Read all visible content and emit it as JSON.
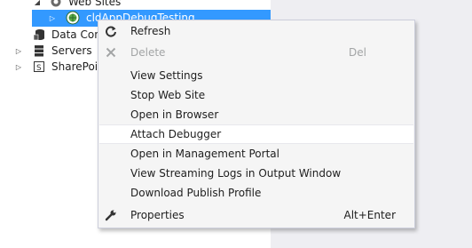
{
  "tree": {
    "items": [
      {
        "label": "Web Sites"
      },
      {
        "label": "cldAppDebugTesting"
      },
      {
        "label": "Data Connections"
      },
      {
        "label": "Servers"
      },
      {
        "label": "SharePoint Connections"
      }
    ]
  },
  "context_menu": {
    "items": [
      {
        "label": "Refresh",
        "icon": "refresh-icon"
      },
      {
        "label": "Delete",
        "shortcut": "Del",
        "icon": "delete-icon",
        "disabled": true
      },
      {
        "label": "View Settings"
      },
      {
        "label": "Stop Web Site"
      },
      {
        "label": "Open in Browser"
      },
      {
        "label": "Attach Debugger",
        "highlighted": true
      },
      {
        "label": "Open in Management Portal"
      },
      {
        "label": "View Streaming Logs in Output Window"
      },
      {
        "label": "Download Publish Profile"
      },
      {
        "label": "Properties",
        "shortcut": "Alt+Enter",
        "icon": "wrench-icon"
      }
    ]
  },
  "colors": {
    "selection": "#3399ff",
    "menu_background": "#f5f5f5",
    "menu_border": "#cccedb",
    "panel_background": "#eeeef2"
  }
}
